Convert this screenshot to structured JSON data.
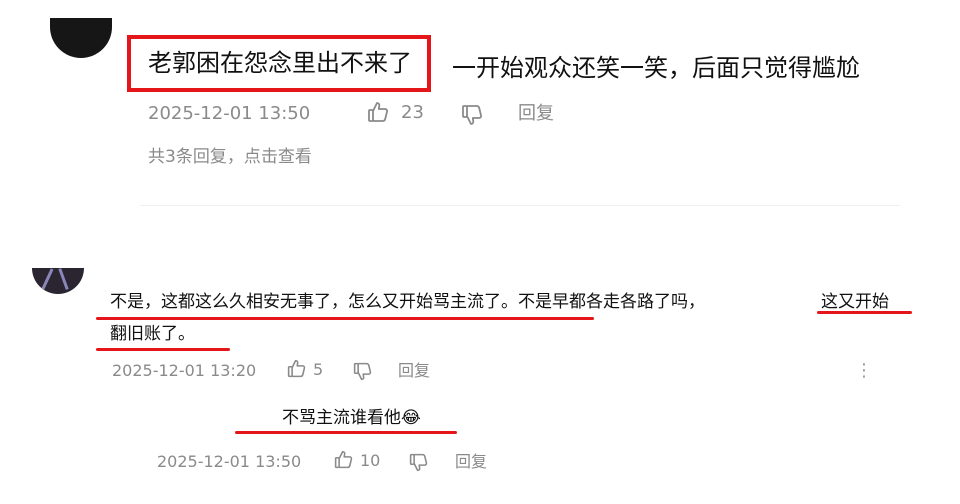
{
  "comment1": {
    "highlighted_text": "老郭困在怨念里出不来了",
    "rest_text": "一开始观众还笑一笑，后面只觉得尴尬",
    "timestamp": "2025-12-01 13:50",
    "likes": "23",
    "reply_label": "回复",
    "replies_summary": "共3条回复，点击查看"
  },
  "comment2": {
    "line1_part1": "不是，这都这么久相安无事了，怎么又开始骂主流了。不是早都各走各路了吗，",
    "line1_part2": "这又开始",
    "line2": "翻旧账了。",
    "timestamp": "2025-12-01 13:20",
    "likes": "5",
    "reply_label": "回复",
    "more_label": "⋮"
  },
  "reply1": {
    "text": "不骂主流谁看他",
    "emoji": "😂",
    "timestamp": "2025-12-01 13:50",
    "likes": "10",
    "reply_label": "回复"
  },
  "colors": {
    "annotation_red": "#e4161a",
    "meta_gray": "#8a8a8a"
  },
  "icons": [
    "thumbs-up-icon",
    "thumbs-down-icon",
    "more-icon"
  ]
}
